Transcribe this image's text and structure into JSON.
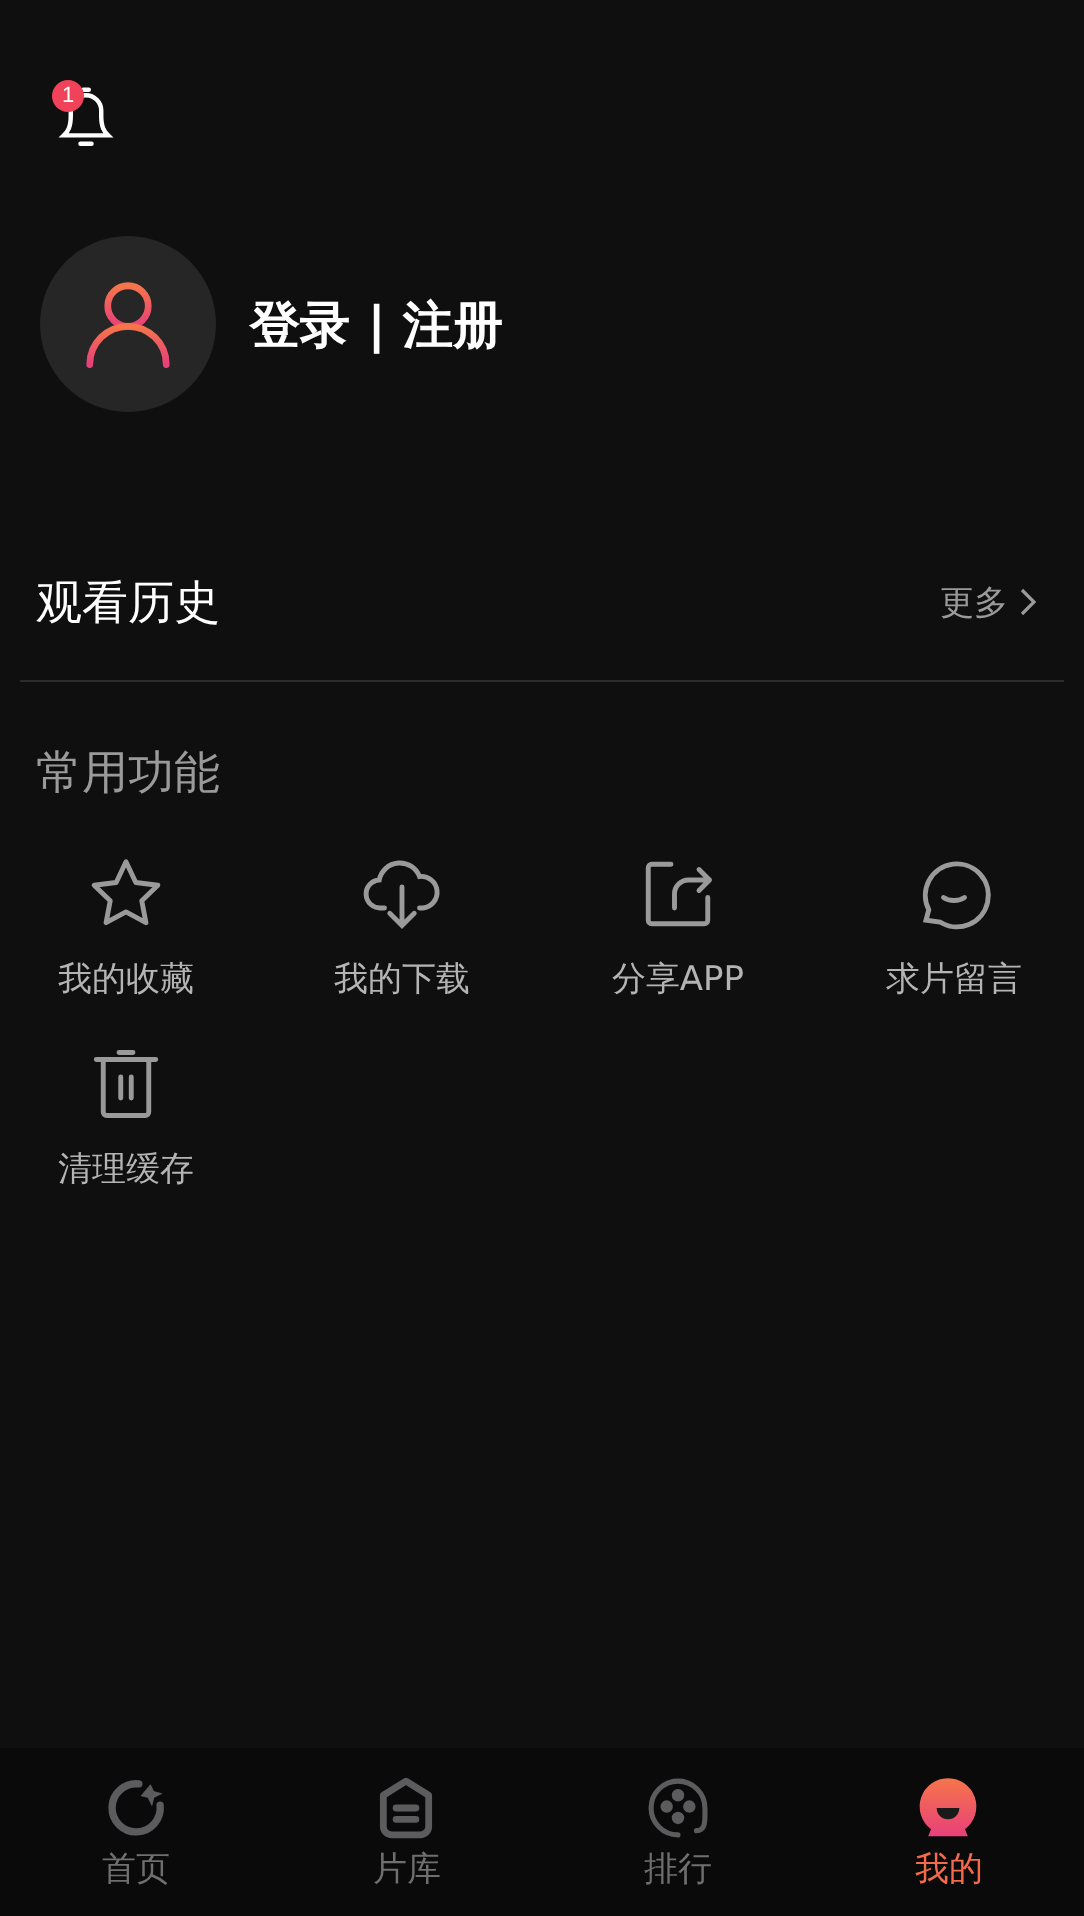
{
  "notification": {
    "badge": "1"
  },
  "profile": {
    "login": "登录 | 注册"
  },
  "history": {
    "title": "观看历史",
    "more": "更多"
  },
  "functions": {
    "title": "常用功能",
    "items": [
      {
        "label": "我的收藏"
      },
      {
        "label": "我的下载"
      },
      {
        "label": "分享APP"
      },
      {
        "label": "求片留言"
      },
      {
        "label": "清理缓存"
      }
    ]
  },
  "tab_bar": [
    {
      "label": "首页",
      "selected": false
    },
    {
      "label": "片库",
      "selected": false
    },
    {
      "label": "排行",
      "selected": false
    },
    {
      "label": "我的",
      "selected": true
    }
  ]
}
